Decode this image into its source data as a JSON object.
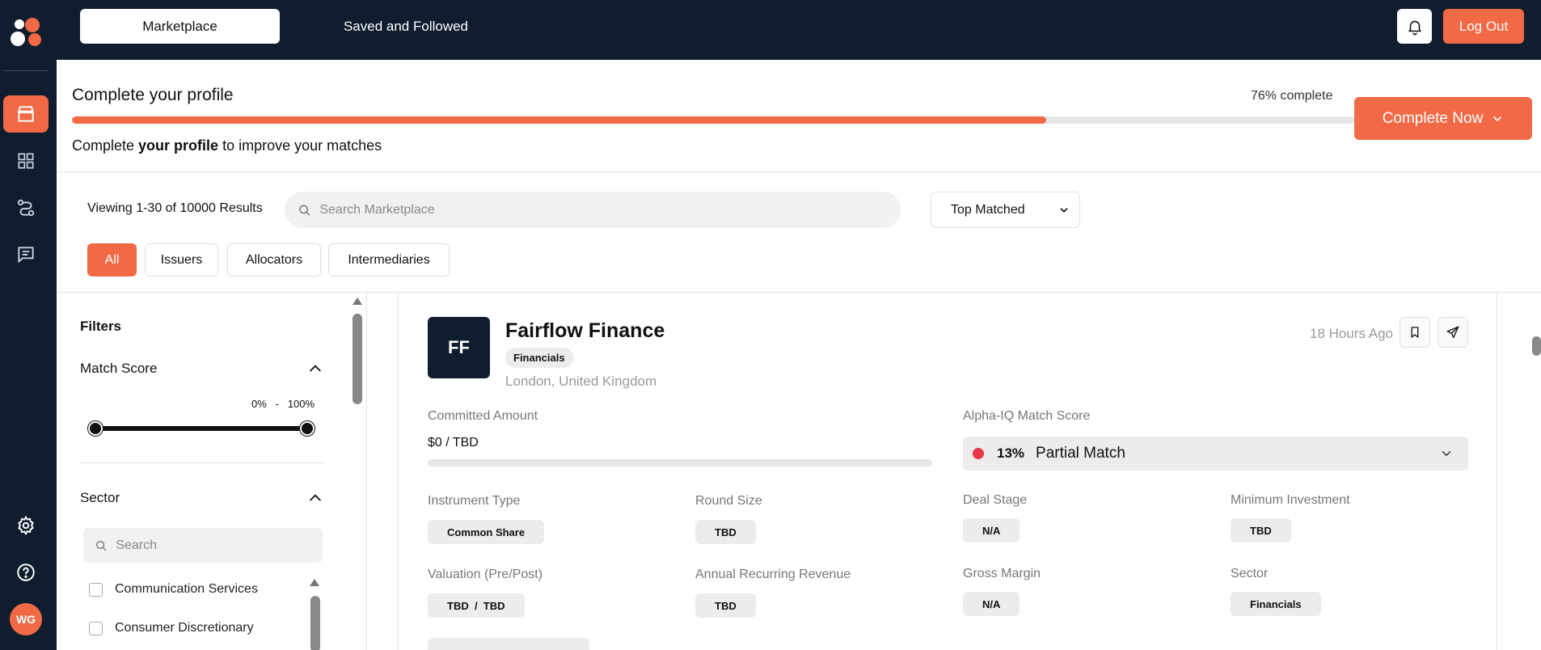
{
  "topbar": {
    "tabs": [
      {
        "label": "Marketplace"
      },
      {
        "label": "Saved and Followed"
      }
    ],
    "logout_label": "Log Out"
  },
  "user": {
    "initials": "WG"
  },
  "profile": {
    "title": "Complete your profile",
    "percent_label": "76% complete",
    "percent": 76,
    "subtitle_pre": "Complete ",
    "subtitle_bold": "your profile",
    "subtitle_post": " to improve your matches",
    "cta_label": "Complete Now"
  },
  "toolbar": {
    "viewing": "Viewing 1-30 of 10000 Results",
    "search_placeholder": "Search Marketplace",
    "sort_selected": "Top Matched",
    "chips": [
      {
        "label": "All",
        "active": true
      },
      {
        "label": "Issuers"
      },
      {
        "label": "Allocators"
      },
      {
        "label": "Intermediaries"
      }
    ]
  },
  "filters": {
    "title": "Filters",
    "match_score": {
      "title": "Match Score",
      "min_label": "0%",
      "sep": "-",
      "max_label": "100%",
      "min": 0,
      "max": 100
    },
    "sector": {
      "title": "Sector",
      "search_placeholder": "Search",
      "options": [
        {
          "label": "Communication Services"
        },
        {
          "label": "Consumer Discretionary"
        }
      ]
    }
  },
  "card": {
    "initials": "FF",
    "name": "Fairflow Finance",
    "tag": "Financials",
    "location": "London, United Kingdom",
    "time": "18 Hours Ago",
    "committed": {
      "label": "Committed Amount",
      "value": "$0 / TBD"
    },
    "match": {
      "label": "Alpha-IQ Match Score",
      "percent": "13%",
      "status": "Partial Match",
      "color": "#e8394a"
    },
    "fields": {
      "instrument_type": {
        "label": "Instrument Type",
        "value": "Common Share"
      },
      "round_size": {
        "label": "Round Size",
        "value": "TBD"
      },
      "deal_stage": {
        "label": "Deal Stage",
        "value": "N/A"
      },
      "min_investment": {
        "label": "Minimum Investment",
        "value": "TBD"
      },
      "valuation": {
        "label": "Valuation (Pre/Post)",
        "value": "TBD  /  TBD"
      },
      "arr": {
        "label": "Annual Recurring Revenue",
        "value": "TBD"
      },
      "gross_margin": {
        "label": "Gross Margin",
        "value": "N/A"
      },
      "sector": {
        "label": "Sector",
        "value": "Financials"
      }
    }
  },
  "colors": {
    "accent": "#f26a45",
    "navy": "#0f1d2e"
  }
}
